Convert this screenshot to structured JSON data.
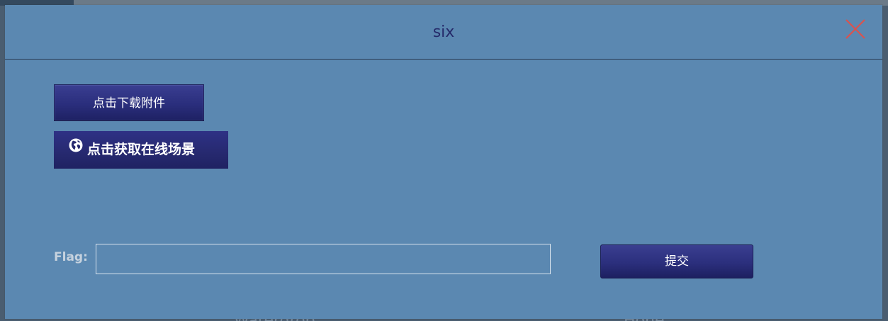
{
  "modal": {
    "title": "six",
    "close_icon": "close-icon",
    "download_button_label": "点击下载附件",
    "scene_button_label": "点击获取在线场景",
    "scene_button_icon": "globe-icon",
    "flag_label": "Flag:",
    "flag_input_value": "",
    "flag_input_placeholder": "",
    "submit_button_label": "提交"
  },
  "background": {
    "bottom_text_1": "Waterdrop",
    "bottom_text_2": "Hone"
  },
  "colors": {
    "modal_bg": "#5b88b1",
    "title": "#252a6a",
    "close_x": "#d9534f",
    "button_bg": "#2a2e7c",
    "label": "#c6d2de"
  }
}
